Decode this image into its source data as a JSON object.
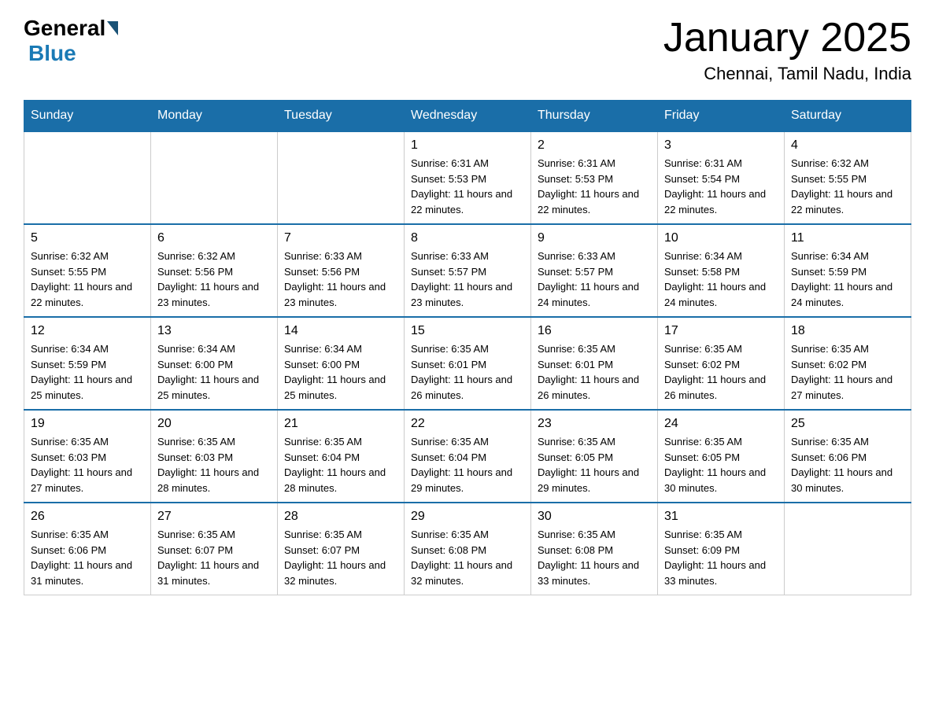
{
  "header": {
    "logo_general": "General",
    "logo_blue": "Blue",
    "month_title": "January 2025",
    "location": "Chennai, Tamil Nadu, India"
  },
  "days_of_week": [
    "Sunday",
    "Monday",
    "Tuesday",
    "Wednesday",
    "Thursday",
    "Friday",
    "Saturday"
  ],
  "weeks": [
    {
      "cells": [
        {
          "day": null
        },
        {
          "day": null
        },
        {
          "day": null
        },
        {
          "day": "1",
          "sunrise": "Sunrise: 6:31 AM",
          "sunset": "Sunset: 5:53 PM",
          "daylight": "Daylight: 11 hours and 22 minutes."
        },
        {
          "day": "2",
          "sunrise": "Sunrise: 6:31 AM",
          "sunset": "Sunset: 5:53 PM",
          "daylight": "Daylight: 11 hours and 22 minutes."
        },
        {
          "day": "3",
          "sunrise": "Sunrise: 6:31 AM",
          "sunset": "Sunset: 5:54 PM",
          "daylight": "Daylight: 11 hours and 22 minutes."
        },
        {
          "day": "4",
          "sunrise": "Sunrise: 6:32 AM",
          "sunset": "Sunset: 5:55 PM",
          "daylight": "Daylight: 11 hours and 22 minutes."
        }
      ]
    },
    {
      "cells": [
        {
          "day": "5",
          "sunrise": "Sunrise: 6:32 AM",
          "sunset": "Sunset: 5:55 PM",
          "daylight": "Daylight: 11 hours and 22 minutes."
        },
        {
          "day": "6",
          "sunrise": "Sunrise: 6:32 AM",
          "sunset": "Sunset: 5:56 PM",
          "daylight": "Daylight: 11 hours and 23 minutes."
        },
        {
          "day": "7",
          "sunrise": "Sunrise: 6:33 AM",
          "sunset": "Sunset: 5:56 PM",
          "daylight": "Daylight: 11 hours and 23 minutes."
        },
        {
          "day": "8",
          "sunrise": "Sunrise: 6:33 AM",
          "sunset": "Sunset: 5:57 PM",
          "daylight": "Daylight: 11 hours and 23 minutes."
        },
        {
          "day": "9",
          "sunrise": "Sunrise: 6:33 AM",
          "sunset": "Sunset: 5:57 PM",
          "daylight": "Daylight: 11 hours and 24 minutes."
        },
        {
          "day": "10",
          "sunrise": "Sunrise: 6:34 AM",
          "sunset": "Sunset: 5:58 PM",
          "daylight": "Daylight: 11 hours and 24 minutes."
        },
        {
          "day": "11",
          "sunrise": "Sunrise: 6:34 AM",
          "sunset": "Sunset: 5:59 PM",
          "daylight": "Daylight: 11 hours and 24 minutes."
        }
      ]
    },
    {
      "cells": [
        {
          "day": "12",
          "sunrise": "Sunrise: 6:34 AM",
          "sunset": "Sunset: 5:59 PM",
          "daylight": "Daylight: 11 hours and 25 minutes."
        },
        {
          "day": "13",
          "sunrise": "Sunrise: 6:34 AM",
          "sunset": "Sunset: 6:00 PM",
          "daylight": "Daylight: 11 hours and 25 minutes."
        },
        {
          "day": "14",
          "sunrise": "Sunrise: 6:34 AM",
          "sunset": "Sunset: 6:00 PM",
          "daylight": "Daylight: 11 hours and 25 minutes."
        },
        {
          "day": "15",
          "sunrise": "Sunrise: 6:35 AM",
          "sunset": "Sunset: 6:01 PM",
          "daylight": "Daylight: 11 hours and 26 minutes."
        },
        {
          "day": "16",
          "sunrise": "Sunrise: 6:35 AM",
          "sunset": "Sunset: 6:01 PM",
          "daylight": "Daylight: 11 hours and 26 minutes."
        },
        {
          "day": "17",
          "sunrise": "Sunrise: 6:35 AM",
          "sunset": "Sunset: 6:02 PM",
          "daylight": "Daylight: 11 hours and 26 minutes."
        },
        {
          "day": "18",
          "sunrise": "Sunrise: 6:35 AM",
          "sunset": "Sunset: 6:02 PM",
          "daylight": "Daylight: 11 hours and 27 minutes."
        }
      ]
    },
    {
      "cells": [
        {
          "day": "19",
          "sunrise": "Sunrise: 6:35 AM",
          "sunset": "Sunset: 6:03 PM",
          "daylight": "Daylight: 11 hours and 27 minutes."
        },
        {
          "day": "20",
          "sunrise": "Sunrise: 6:35 AM",
          "sunset": "Sunset: 6:03 PM",
          "daylight": "Daylight: 11 hours and 28 minutes."
        },
        {
          "day": "21",
          "sunrise": "Sunrise: 6:35 AM",
          "sunset": "Sunset: 6:04 PM",
          "daylight": "Daylight: 11 hours and 28 minutes."
        },
        {
          "day": "22",
          "sunrise": "Sunrise: 6:35 AM",
          "sunset": "Sunset: 6:04 PM",
          "daylight": "Daylight: 11 hours and 29 minutes."
        },
        {
          "day": "23",
          "sunrise": "Sunrise: 6:35 AM",
          "sunset": "Sunset: 6:05 PM",
          "daylight": "Daylight: 11 hours and 29 minutes."
        },
        {
          "day": "24",
          "sunrise": "Sunrise: 6:35 AM",
          "sunset": "Sunset: 6:05 PM",
          "daylight": "Daylight: 11 hours and 30 minutes."
        },
        {
          "day": "25",
          "sunrise": "Sunrise: 6:35 AM",
          "sunset": "Sunset: 6:06 PM",
          "daylight": "Daylight: 11 hours and 30 minutes."
        }
      ]
    },
    {
      "cells": [
        {
          "day": "26",
          "sunrise": "Sunrise: 6:35 AM",
          "sunset": "Sunset: 6:06 PM",
          "daylight": "Daylight: 11 hours and 31 minutes."
        },
        {
          "day": "27",
          "sunrise": "Sunrise: 6:35 AM",
          "sunset": "Sunset: 6:07 PM",
          "daylight": "Daylight: 11 hours and 31 minutes."
        },
        {
          "day": "28",
          "sunrise": "Sunrise: 6:35 AM",
          "sunset": "Sunset: 6:07 PM",
          "daylight": "Daylight: 11 hours and 32 minutes."
        },
        {
          "day": "29",
          "sunrise": "Sunrise: 6:35 AM",
          "sunset": "Sunset: 6:08 PM",
          "daylight": "Daylight: 11 hours and 32 minutes."
        },
        {
          "day": "30",
          "sunrise": "Sunrise: 6:35 AM",
          "sunset": "Sunset: 6:08 PM",
          "daylight": "Daylight: 11 hours and 33 minutes."
        },
        {
          "day": "31",
          "sunrise": "Sunrise: 6:35 AM",
          "sunset": "Sunset: 6:09 PM",
          "daylight": "Daylight: 11 hours and 33 minutes."
        },
        {
          "day": null
        }
      ]
    }
  ]
}
